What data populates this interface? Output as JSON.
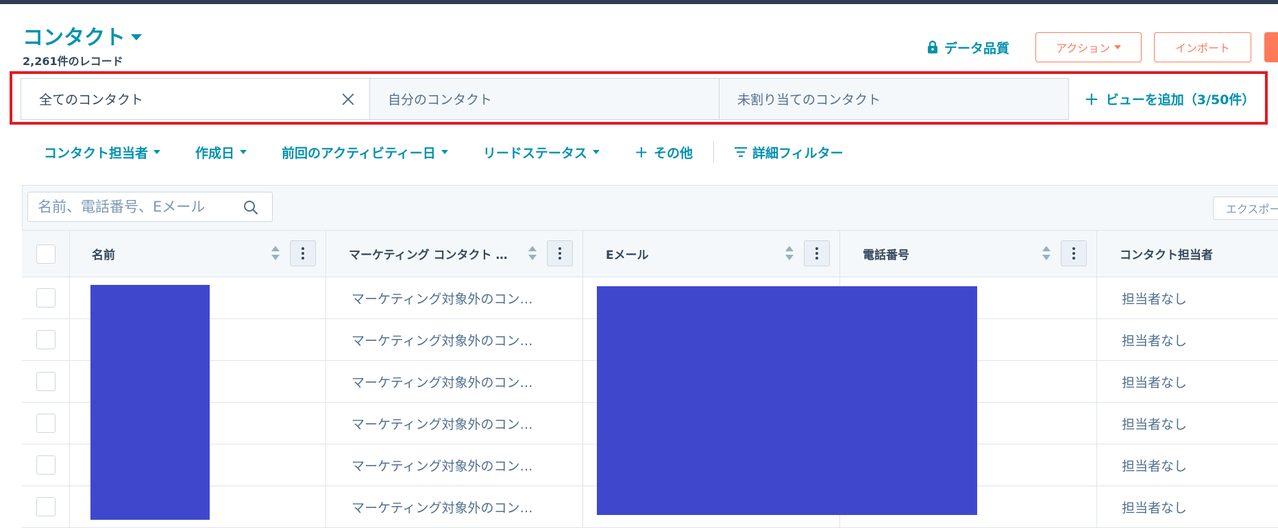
{
  "header": {
    "title": "コンタクト",
    "record_count": "2,261件のレコード",
    "data_quality": "データ品質",
    "action_label": "アクション",
    "import_label": "インポート"
  },
  "views": {
    "tabs": [
      {
        "label": "全てのコンタクト"
      },
      {
        "label": "自分のコンタクト"
      },
      {
        "label": "未割り当てのコンタクト"
      }
    ],
    "add_view": "ビューを追加（3/50件）"
  },
  "filters": {
    "items": [
      {
        "label": "コンタクト担当者"
      },
      {
        "label": "作成日"
      },
      {
        "label": "前回のアクティビティー日"
      },
      {
        "label": "リードステータス"
      }
    ],
    "more": "その他",
    "advanced": "詳細フィルター"
  },
  "search": {
    "placeholder": "名前、電話番号、Eメール"
  },
  "export_label": "エクスポート",
  "table": {
    "columns": [
      {
        "label": "名前"
      },
      {
        "label": "マーケティング コンタクト ステータス"
      },
      {
        "label": "Eメール"
      },
      {
        "label": "電話番号"
      },
      {
        "label": "コンタクト担当者"
      }
    ],
    "rows": [
      {
        "marketing": "マーケティング対象外のコン…",
        "owner": "担当者なし"
      },
      {
        "marketing": "マーケティング対象外のコン…",
        "owner": "担当者なし"
      },
      {
        "marketing": "マーケティング対象外のコン…",
        "owner": "担当者なし"
      },
      {
        "marketing": "マーケティング対象外のコン…",
        "owner": "担当者なし"
      },
      {
        "marketing": "マーケティング対象外のコン…",
        "owner": "担当者なし"
      },
      {
        "marketing": "マーケティング対象外のコン…",
        "owner": "担当者なし"
      }
    ]
  },
  "colors": {
    "accent": "#0091ae",
    "action_orange": "#ff7a59",
    "highlight_red": "#e31b23",
    "redaction_blue": "#3f48cc"
  },
  "icons": [
    "caret-down-icon",
    "lock-icon",
    "close-icon",
    "plus-icon",
    "filter-lines-icon",
    "search-icon",
    "sort-icon",
    "column-menu-icon"
  ]
}
